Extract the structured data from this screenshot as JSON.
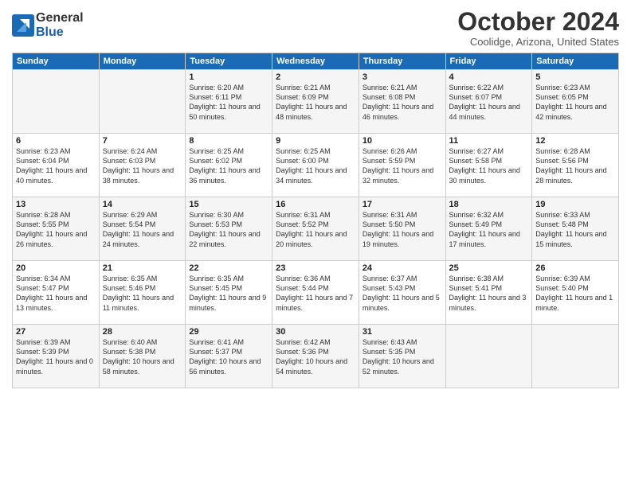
{
  "logo": {
    "general": "General",
    "blue": "Blue"
  },
  "title": "October 2024",
  "location": "Coolidge, Arizona, United States",
  "headers": [
    "Sunday",
    "Monday",
    "Tuesday",
    "Wednesday",
    "Thursday",
    "Friday",
    "Saturday"
  ],
  "weeks": [
    [
      {
        "day": "",
        "info": ""
      },
      {
        "day": "",
        "info": ""
      },
      {
        "day": "1",
        "info": "Sunrise: 6:20 AM\nSunset: 6:11 PM\nDaylight: 11 hours and 50 minutes."
      },
      {
        "day": "2",
        "info": "Sunrise: 6:21 AM\nSunset: 6:09 PM\nDaylight: 11 hours and 48 minutes."
      },
      {
        "day": "3",
        "info": "Sunrise: 6:21 AM\nSunset: 6:08 PM\nDaylight: 11 hours and 46 minutes."
      },
      {
        "day": "4",
        "info": "Sunrise: 6:22 AM\nSunset: 6:07 PM\nDaylight: 11 hours and 44 minutes."
      },
      {
        "day": "5",
        "info": "Sunrise: 6:23 AM\nSunset: 6:05 PM\nDaylight: 11 hours and 42 minutes."
      }
    ],
    [
      {
        "day": "6",
        "info": "Sunrise: 6:23 AM\nSunset: 6:04 PM\nDaylight: 11 hours and 40 minutes."
      },
      {
        "day": "7",
        "info": "Sunrise: 6:24 AM\nSunset: 6:03 PM\nDaylight: 11 hours and 38 minutes."
      },
      {
        "day": "8",
        "info": "Sunrise: 6:25 AM\nSunset: 6:02 PM\nDaylight: 11 hours and 36 minutes."
      },
      {
        "day": "9",
        "info": "Sunrise: 6:25 AM\nSunset: 6:00 PM\nDaylight: 11 hours and 34 minutes."
      },
      {
        "day": "10",
        "info": "Sunrise: 6:26 AM\nSunset: 5:59 PM\nDaylight: 11 hours and 32 minutes."
      },
      {
        "day": "11",
        "info": "Sunrise: 6:27 AM\nSunset: 5:58 PM\nDaylight: 11 hours and 30 minutes."
      },
      {
        "day": "12",
        "info": "Sunrise: 6:28 AM\nSunset: 5:56 PM\nDaylight: 11 hours and 28 minutes."
      }
    ],
    [
      {
        "day": "13",
        "info": "Sunrise: 6:28 AM\nSunset: 5:55 PM\nDaylight: 11 hours and 26 minutes."
      },
      {
        "day": "14",
        "info": "Sunrise: 6:29 AM\nSunset: 5:54 PM\nDaylight: 11 hours and 24 minutes."
      },
      {
        "day": "15",
        "info": "Sunrise: 6:30 AM\nSunset: 5:53 PM\nDaylight: 11 hours and 22 minutes."
      },
      {
        "day": "16",
        "info": "Sunrise: 6:31 AM\nSunset: 5:52 PM\nDaylight: 11 hours and 20 minutes."
      },
      {
        "day": "17",
        "info": "Sunrise: 6:31 AM\nSunset: 5:50 PM\nDaylight: 11 hours and 19 minutes."
      },
      {
        "day": "18",
        "info": "Sunrise: 6:32 AM\nSunset: 5:49 PM\nDaylight: 11 hours and 17 minutes."
      },
      {
        "day": "19",
        "info": "Sunrise: 6:33 AM\nSunset: 5:48 PM\nDaylight: 11 hours and 15 minutes."
      }
    ],
    [
      {
        "day": "20",
        "info": "Sunrise: 6:34 AM\nSunset: 5:47 PM\nDaylight: 11 hours and 13 minutes."
      },
      {
        "day": "21",
        "info": "Sunrise: 6:35 AM\nSunset: 5:46 PM\nDaylight: 11 hours and 11 minutes."
      },
      {
        "day": "22",
        "info": "Sunrise: 6:35 AM\nSunset: 5:45 PM\nDaylight: 11 hours and 9 minutes."
      },
      {
        "day": "23",
        "info": "Sunrise: 6:36 AM\nSunset: 5:44 PM\nDaylight: 11 hours and 7 minutes."
      },
      {
        "day": "24",
        "info": "Sunrise: 6:37 AM\nSunset: 5:43 PM\nDaylight: 11 hours and 5 minutes."
      },
      {
        "day": "25",
        "info": "Sunrise: 6:38 AM\nSunset: 5:41 PM\nDaylight: 11 hours and 3 minutes."
      },
      {
        "day": "26",
        "info": "Sunrise: 6:39 AM\nSunset: 5:40 PM\nDaylight: 11 hours and 1 minute."
      }
    ],
    [
      {
        "day": "27",
        "info": "Sunrise: 6:39 AM\nSunset: 5:39 PM\nDaylight: 11 hours and 0 minutes."
      },
      {
        "day": "28",
        "info": "Sunrise: 6:40 AM\nSunset: 5:38 PM\nDaylight: 10 hours and 58 minutes."
      },
      {
        "day": "29",
        "info": "Sunrise: 6:41 AM\nSunset: 5:37 PM\nDaylight: 10 hours and 56 minutes."
      },
      {
        "day": "30",
        "info": "Sunrise: 6:42 AM\nSunset: 5:36 PM\nDaylight: 10 hours and 54 minutes."
      },
      {
        "day": "31",
        "info": "Sunrise: 6:43 AM\nSunset: 5:35 PM\nDaylight: 10 hours and 52 minutes."
      },
      {
        "day": "",
        "info": ""
      },
      {
        "day": "",
        "info": ""
      }
    ]
  ]
}
